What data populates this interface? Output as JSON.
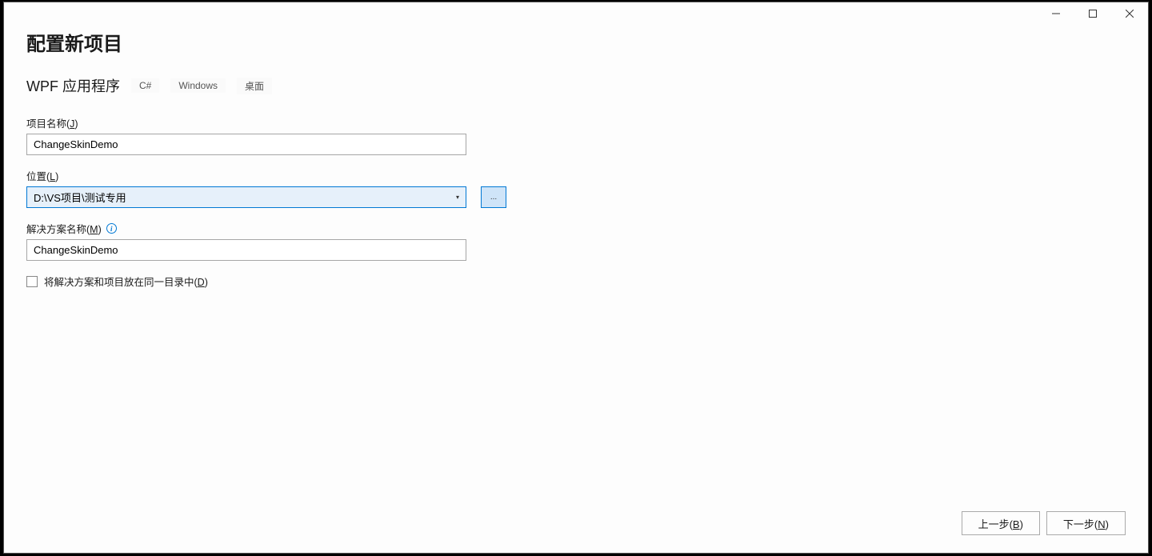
{
  "page": {
    "title": "配置新项目"
  },
  "template": {
    "name": "WPF 应用程序",
    "tags": [
      "C#",
      "Windows",
      "桌面"
    ]
  },
  "fields": {
    "projectName": {
      "labelPrefix": "项目名称(",
      "labelKey": "J",
      "labelSuffix": ")",
      "value": "ChangeSkinDemo"
    },
    "location": {
      "labelPrefix": "位置(",
      "labelKey": "L",
      "labelSuffix": ")",
      "value": "D:\\VS项目\\测试专用",
      "browseLabel": "..."
    },
    "solutionName": {
      "labelPrefix": "解决方案名称(",
      "labelKey": "M",
      "labelSuffix": ")",
      "value": "ChangeSkinDemo"
    },
    "sameDirCheckbox": {
      "labelPrefix": "将解决方案和项目放在同一目录中(",
      "labelKey": "D",
      "labelSuffix": ")",
      "checked": false
    }
  },
  "footer": {
    "back": {
      "prefix": "上一步(",
      "key": "B",
      "suffix": ")"
    },
    "next": {
      "prefix": "下一步(",
      "key": "N",
      "suffix": ")"
    }
  }
}
